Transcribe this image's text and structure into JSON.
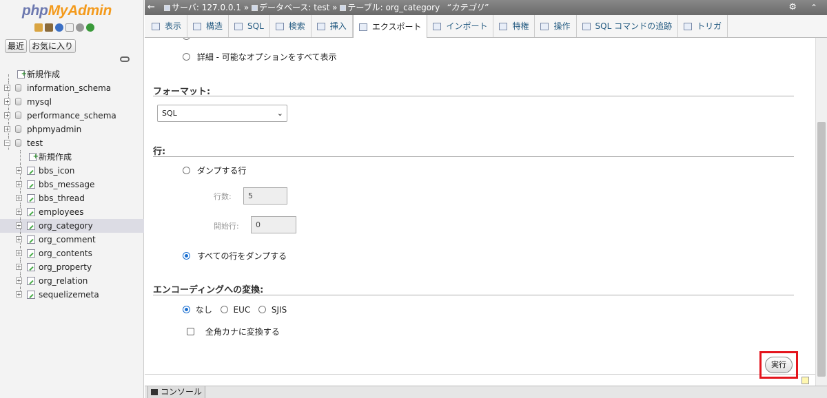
{
  "logo": {
    "php": "php",
    "rest": "MyAdmin"
  },
  "nav": {
    "recent_label": "最近",
    "favorites_label": "お気に入り",
    "tree": [
      {
        "label": "新規作成",
        "level": 0,
        "kind": "new"
      },
      {
        "label": "information_schema",
        "level": 0,
        "kind": "db"
      },
      {
        "label": "mysql",
        "level": 0,
        "kind": "db"
      },
      {
        "label": "performance_schema",
        "level": 0,
        "kind": "db"
      },
      {
        "label": "phpmyadmin",
        "level": 0,
        "kind": "db"
      },
      {
        "label": "test",
        "level": 0,
        "kind": "db-open"
      },
      {
        "label": "新規作成",
        "level": 1,
        "kind": "new"
      },
      {
        "label": "bbs_icon",
        "level": 1,
        "kind": "table"
      },
      {
        "label": "bbs_message",
        "level": 1,
        "kind": "table"
      },
      {
        "label": "bbs_thread",
        "level": 1,
        "kind": "table"
      },
      {
        "label": "employees",
        "level": 1,
        "kind": "table"
      },
      {
        "label": "org_category",
        "level": 1,
        "kind": "table",
        "selected": true
      },
      {
        "label": "org_comment",
        "level": 1,
        "kind": "table"
      },
      {
        "label": "org_contents",
        "level": 1,
        "kind": "table"
      },
      {
        "label": "org_property",
        "level": 1,
        "kind": "table"
      },
      {
        "label": "org_relation",
        "level": 1,
        "kind": "table"
      },
      {
        "label": "sequelizemeta",
        "level": 1,
        "kind": "table"
      }
    ]
  },
  "topbar": {
    "server": "サーバ: 127.0.0.1",
    "sep": "»",
    "database": "データベース: test",
    "table": "テーブル: org_category",
    "comment": "“カテゴリ”"
  },
  "tabs": [
    {
      "label": "表示",
      "active": false
    },
    {
      "label": "構造",
      "active": false
    },
    {
      "label": "SQL",
      "active": false
    },
    {
      "label": "検索",
      "active": false
    },
    {
      "label": "挿入",
      "active": false
    },
    {
      "label": "エクスポート",
      "active": true
    },
    {
      "label": "インポート",
      "active": false
    },
    {
      "label": "特権",
      "active": false
    },
    {
      "label": "操作",
      "active": false
    },
    {
      "label": "SQL コマンドの追跡",
      "active": false
    },
    {
      "label": "トリガ",
      "active": false
    }
  ],
  "main": {
    "method_custom_label": "詳細 - 可能なオプションをすべて表示",
    "format_title": "フォーマット:",
    "format_value": "SQL",
    "rows_title": "行:",
    "dump_some_label": "ダンプする行",
    "row_count_label": "行数:",
    "row_count_value": "5",
    "start_row_label": "開始行:",
    "start_row_value": "0",
    "dump_all_label": "すべての行をダンプする",
    "encoding_title": "エンコーディングへの変換:",
    "enc_none": "なし",
    "enc_euc": "EUC",
    "enc_sjis": "SJIS",
    "kana_label": "全角カナに変換する",
    "go_label": "実行"
  },
  "console": {
    "label": "コンソール"
  },
  "colors": {
    "logo_php": "#6c78af",
    "logo_rest": "#f39a1c",
    "highlight": "#e4141c",
    "radio_on": "#1a6fd1"
  }
}
